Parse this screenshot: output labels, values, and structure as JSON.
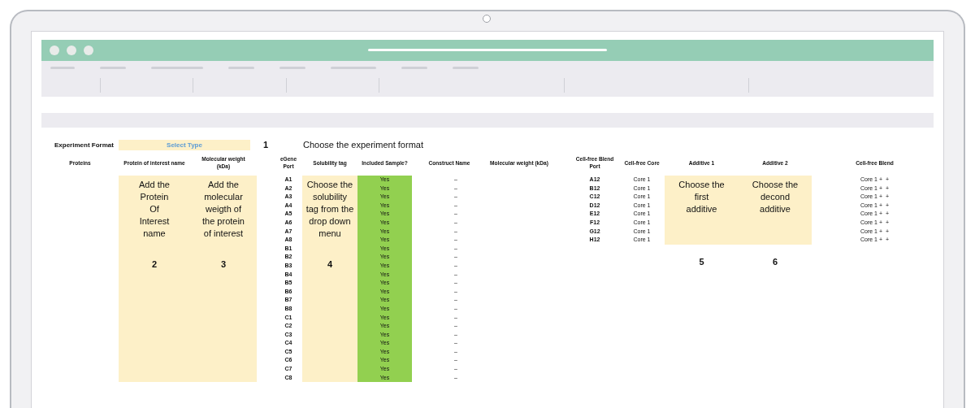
{
  "format": {
    "label": "Experiment Format",
    "value": "Select Type",
    "step": "1",
    "instruction": "Choose the experiment format"
  },
  "columns": {
    "proteins": "Proteins",
    "protein_name": "Protein of interest name",
    "molecular_weight": "Molecular weight\n(kDa)",
    "port": "eGene\nPort",
    "solubility_tag": "Solubility tag",
    "included": "Included Sample?",
    "construct_name": "Construct Name",
    "construct_weight": "Molecular weight (kDa)"
  },
  "protein_name": {
    "hint": "Add the\nProtein\nOf\nInterest\nname",
    "step": "2"
  },
  "molecular_weight": {
    "hint": "Add the\nmolecular\nweigth of\nthe protein\nof interest",
    "step": "3"
  },
  "solubility_tag": {
    "hint": "Choose the\nsolubility\ntag from the\ndrop down\nmenu",
    "step": "4"
  },
  "samples": [
    {
      "port": "A1",
      "included": "Yes",
      "construct_name": "–"
    },
    {
      "port": "A2",
      "included": "Yes",
      "construct_name": "–"
    },
    {
      "port": "A3",
      "included": "Yes",
      "construct_name": "–"
    },
    {
      "port": "A4",
      "included": "Yes",
      "construct_name": "–"
    },
    {
      "port": "A5",
      "included": "Yes",
      "construct_name": "–"
    },
    {
      "port": "A6",
      "included": "Yes",
      "construct_name": "–"
    },
    {
      "port": "A7",
      "included": "Yes",
      "construct_name": "–"
    },
    {
      "port": "A8",
      "included": "Yes",
      "construct_name": "–"
    },
    {
      "port": "B1",
      "included": "Yes",
      "construct_name": "–"
    },
    {
      "port": "B2",
      "included": "Yes",
      "construct_name": "–"
    },
    {
      "port": "B3",
      "included": "Yes",
      "construct_name": "–"
    },
    {
      "port": "B4",
      "included": "Yes",
      "construct_name": "–"
    },
    {
      "port": "B5",
      "included": "Yes",
      "construct_name": "–"
    },
    {
      "port": "B6",
      "included": "Yes",
      "construct_name": "–"
    },
    {
      "port": "B7",
      "included": "Yes",
      "construct_name": "–"
    },
    {
      "port": "B8",
      "included": "Yes",
      "construct_name": "–"
    },
    {
      "port": "C1",
      "included": "Yes",
      "construct_name": "–"
    },
    {
      "port": "C2",
      "included": "Yes",
      "construct_name": "–"
    },
    {
      "port": "C3",
      "included": "Yes",
      "construct_name": "–"
    },
    {
      "port": "C4",
      "included": "Yes",
      "construct_name": "–"
    },
    {
      "port": "C5",
      "included": "Yes",
      "construct_name": "–"
    },
    {
      "port": "C6",
      "included": "Yes",
      "construct_name": "–"
    },
    {
      "port": "C7",
      "included": "Yes",
      "construct_name": "–"
    },
    {
      "port": "C8",
      "included": "Yes",
      "construct_name": "–"
    }
  ],
  "blend_columns": {
    "port": "Cell-free Blend\nPort",
    "core": "Cell-free Core",
    "blend": "Cell-free Blend"
  },
  "additives": [
    {
      "header": "Additive 1",
      "hint": "Choose the\nfirst\nadditive",
      "step": "5"
    },
    {
      "header": "Additive 2",
      "hint": "Choose the\ndecond\nadditive",
      "step": "6"
    }
  ],
  "blend_rows": [
    {
      "port": "A12",
      "core": "Core 1",
      "blend": "Core 1 +  +"
    },
    {
      "port": "B12",
      "core": "Core 1",
      "blend": "Core 1 +  +"
    },
    {
      "port": "C12",
      "core": "Core 1",
      "blend": "Core 1 +  +"
    },
    {
      "port": "D12",
      "core": "Core 1",
      "blend": "Core 1 +  +"
    },
    {
      "port": "E12",
      "core": "Core 1",
      "blend": "Core 1 +  +"
    },
    {
      "port": "F12",
      "core": "Core 1",
      "blend": "Core 1 +  +"
    },
    {
      "port": "G12",
      "core": "Core 1",
      "blend": "Core 1 +  +"
    },
    {
      "port": "H12",
      "core": "Core 1",
      "blend": "Core 1 +  +"
    }
  ]
}
